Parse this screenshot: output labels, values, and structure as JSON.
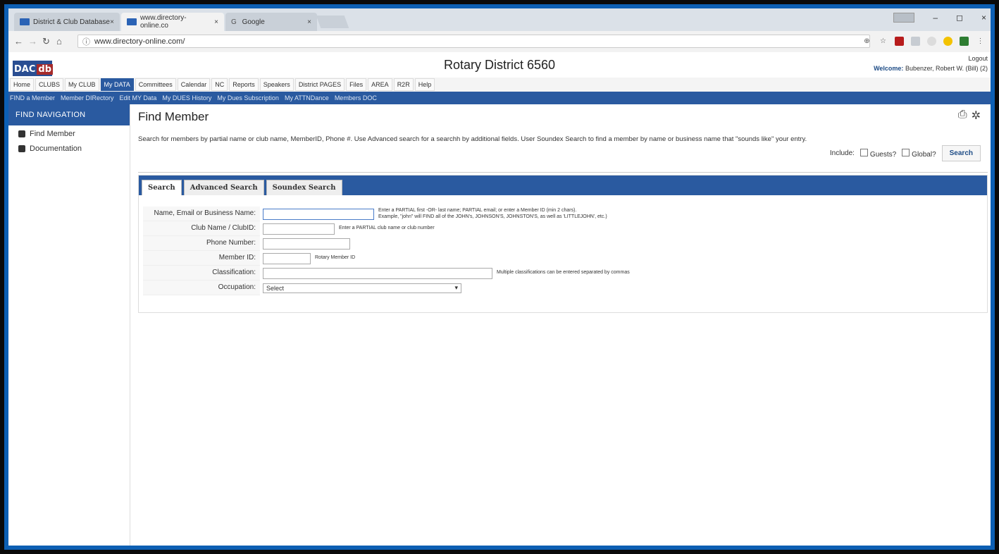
{
  "browser": {
    "tabs": [
      {
        "label": "District & Club Database",
        "close": "×"
      },
      {
        "label": "www.directory-online.co",
        "close": "×"
      },
      {
        "label": "Google",
        "close": "×",
        "favicon": "G"
      }
    ],
    "url": "www.directory-online.com/",
    "window_controls": [
      "–",
      "◻",
      "×"
    ]
  },
  "header": {
    "logo_left": "DAC",
    "logo_right": "db",
    "title": "Rotary District 6560",
    "logout": "Logout",
    "welcome_label": "Welcome:",
    "welcome_user": "Bubenzer, Robert W. (Bill) (2)"
  },
  "main_nav": [
    "Home",
    "CLUBS",
    "My CLUB",
    "My DATA",
    "Committees",
    "Calendar",
    "NC",
    "Reports",
    "Speakers",
    "District PAGES",
    "Files",
    "AREA",
    "R2R",
    "Help"
  ],
  "sub_nav": [
    "FIND a Member",
    "Member DIRectory",
    "Edit MY Data",
    "My DUES History",
    "My Dues Subscription",
    "My ATTNDance",
    "Members DOC"
  ],
  "sidebar": {
    "header": "FIND NAVIGATION",
    "items": [
      {
        "label": "Find Member",
        "icon": "binoculars-icon"
      },
      {
        "label": "Documentation",
        "icon": "book-icon"
      }
    ]
  },
  "page": {
    "title": "Find Member",
    "description": "Search for members by partial name or club name, MemberID, Phone #. Use Advanced search for a searchh by additional fields. User Soundex Search to find a member by name or business name that \"sounds like\" your entry.",
    "include_label": "Include:",
    "guests_label": "Guests?",
    "global_label": "Global?",
    "search_button": "Search"
  },
  "search_tabs": [
    "Search",
    "Advanced Search",
    "Soundex Search"
  ],
  "form": {
    "name_label": "Name, Email or Business Name:",
    "name_hint_1": "Enter a PARTIAL first -OR- last name; PARTIAL email; or enter a Member ID (min 2 chars).",
    "name_hint_2": "Example, \"john\" will FIND all of the JOHN's, JOHNSON'S, JOHNSTON'S, as well as 'LITTLEJOHN', etc.)",
    "club_label": "Club Name / ClubID:",
    "club_hint": "Enter a PARTIAL club name or club number",
    "phone_label": "Phone Number:",
    "member_label": "Member ID:",
    "member_hint": "Rotary Member ID",
    "class_label": "Classification:",
    "class_hint": "Multiple classifications can be entered separated by commas",
    "occupation_label": "Occupation:",
    "occupation_value": "Select"
  }
}
